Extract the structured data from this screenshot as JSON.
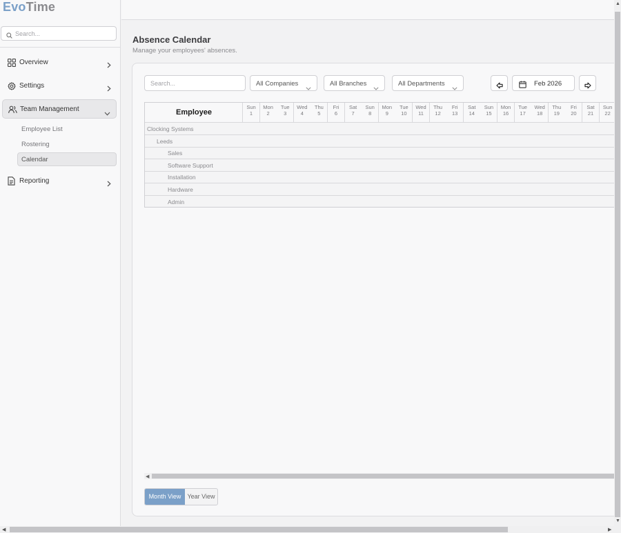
{
  "app": {
    "brand_a": "Evo",
    "brand_b": "Time",
    "brand_color": "#7ba0c8"
  },
  "sidebar": {
    "search_placeholder": "Search...",
    "items": [
      {
        "label": "Overview",
        "icon": "grid-icon",
        "expanded": false
      },
      {
        "label": "Settings",
        "icon": "gear-icon",
        "expanded": false
      },
      {
        "label": "Team Management",
        "icon": "users-icon",
        "expanded": true
      },
      {
        "label": "Reporting",
        "icon": "document-icon",
        "expanded": false
      }
    ],
    "subitems": [
      {
        "label": "Employee List",
        "active": false
      },
      {
        "label": "Rostering",
        "active": false
      },
      {
        "label": "Calendar",
        "active": true
      }
    ]
  },
  "page": {
    "title": "Absence Calendar",
    "subtitle": "Manage your employees' absences."
  },
  "filters": {
    "search_placeholder": "Search...",
    "companies": "All Companies",
    "branches": "All Branches",
    "departments": "All Departments",
    "month": "Feb 2026"
  },
  "grid": {
    "employee_header": "Employee",
    "days": [
      {
        "name": "Sun",
        "num": "1"
      },
      {
        "name": "Mon",
        "num": "2"
      },
      {
        "name": "Tue",
        "num": "3"
      },
      {
        "name": "Wed",
        "num": "4"
      },
      {
        "name": "Thu",
        "num": "5"
      },
      {
        "name": "Fri",
        "num": "6"
      },
      {
        "name": "Sat",
        "num": "7"
      },
      {
        "name": "Sun",
        "num": "8"
      },
      {
        "name": "Mon",
        "num": "9"
      },
      {
        "name": "Tue",
        "num": "10"
      },
      {
        "name": "Wed",
        "num": "11"
      },
      {
        "name": "Thu",
        "num": "12"
      },
      {
        "name": "Fri",
        "num": "13"
      },
      {
        "name": "Sat",
        "num": "14"
      },
      {
        "name": "Sun",
        "num": "15"
      },
      {
        "name": "Mon",
        "num": "16"
      },
      {
        "name": "Tue",
        "num": "17"
      },
      {
        "name": "Wed",
        "num": "18"
      },
      {
        "name": "Thu",
        "num": "19"
      },
      {
        "name": "Fri",
        "num": "20"
      },
      {
        "name": "Sat",
        "num": "21"
      },
      {
        "name": "Sun",
        "num": "22"
      }
    ],
    "rows": [
      {
        "label": "Clocking Systems",
        "level": 0
      },
      {
        "label": "Leeds",
        "level": 1
      },
      {
        "label": "Sales",
        "level": 2
      },
      {
        "label": "Software Support",
        "level": 2
      },
      {
        "label": "Installation",
        "level": 2
      },
      {
        "label": "Hardware",
        "level": 2
      },
      {
        "label": "Admin",
        "level": 2
      }
    ]
  },
  "view_toggle": {
    "month": "Month View",
    "year": "Year View",
    "selected": "Month View"
  }
}
